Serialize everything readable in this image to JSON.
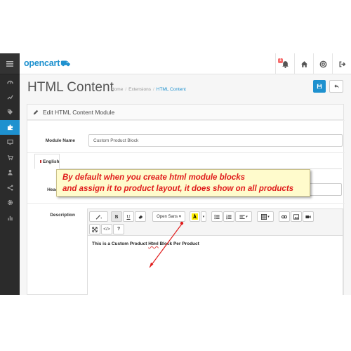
{
  "brand": {
    "logo_text": "opencart"
  },
  "colors": {
    "accent": "#1e91cf",
    "nav_bg": "#2b2b2b",
    "callout_text": "#e01b1b",
    "callout_bg": "#fffbcc"
  },
  "header": {
    "notification_count": "1",
    "icons": [
      "bell-icon",
      "home-icon",
      "globe-icon",
      "logout-icon"
    ]
  },
  "sidebar": {
    "items": [
      "dashboard-icon",
      "catalog-icon",
      "tag-icon",
      "extension-icon",
      "design-icon",
      "sales-icon",
      "customer-icon",
      "marketing-icon",
      "system-icon",
      "reports-icon"
    ],
    "active_index": 3
  },
  "page": {
    "title": "HTML Content",
    "breadcrumb": [
      "Home",
      "Extensions",
      "HTML Content"
    ]
  },
  "panel": {
    "heading": "Edit HTML Content Module",
    "module_name_label": "Module Name",
    "module_name_value": "Custom Product Block",
    "language_tab": "English",
    "heading_label": "Head",
    "description_label": "Description"
  },
  "editor": {
    "font_select": "Open Sans",
    "content": "This is a Custom Product",
    "content_misspelled": "Html",
    "content_tail": "Block Per Product"
  },
  "callout": {
    "line1": "By default when you create html module blocks",
    "line2": "and assign it to product layout, it does show on all products"
  }
}
